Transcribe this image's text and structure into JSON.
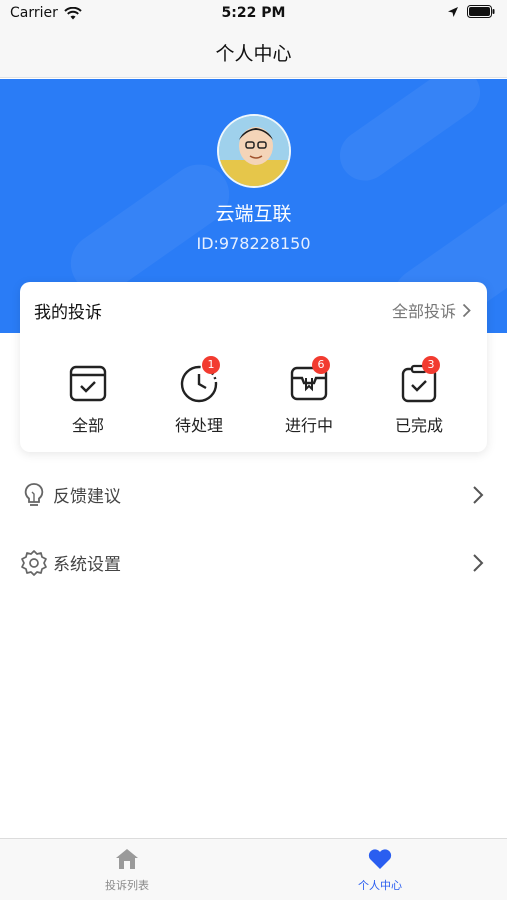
{
  "status_bar": {
    "carrier": "Carrier",
    "time": "5:22 PM"
  },
  "nav": {
    "title": "个人中心"
  },
  "profile": {
    "name": "云端互联",
    "id_text": "ID:978228150"
  },
  "complaints": {
    "title": "我的投诉",
    "view_all": "全部投诉",
    "items": [
      {
        "label": "全部",
        "icon": "calendar-check-icon",
        "badge": ""
      },
      {
        "label": "待处理",
        "icon": "clock-pending-icon",
        "badge": "1"
      },
      {
        "label": "进行中",
        "icon": "inbox-progress-icon",
        "badge": "6"
      },
      {
        "label": "已完成",
        "icon": "clipboard-check-icon",
        "badge": "3"
      }
    ]
  },
  "menu": [
    {
      "label": "反馈建议",
      "icon": "lightbulb-icon"
    },
    {
      "label": "系统设置",
      "icon": "gear-icon"
    }
  ],
  "tabs": [
    {
      "label": "投诉列表",
      "icon": "home-icon",
      "active": false
    },
    {
      "label": "个人中心",
      "icon": "heart-icon",
      "active": true
    }
  ],
  "colors": {
    "primary": "#2a7cf6",
    "tab_active": "#2a5ef0",
    "badge": "#f23b30"
  }
}
